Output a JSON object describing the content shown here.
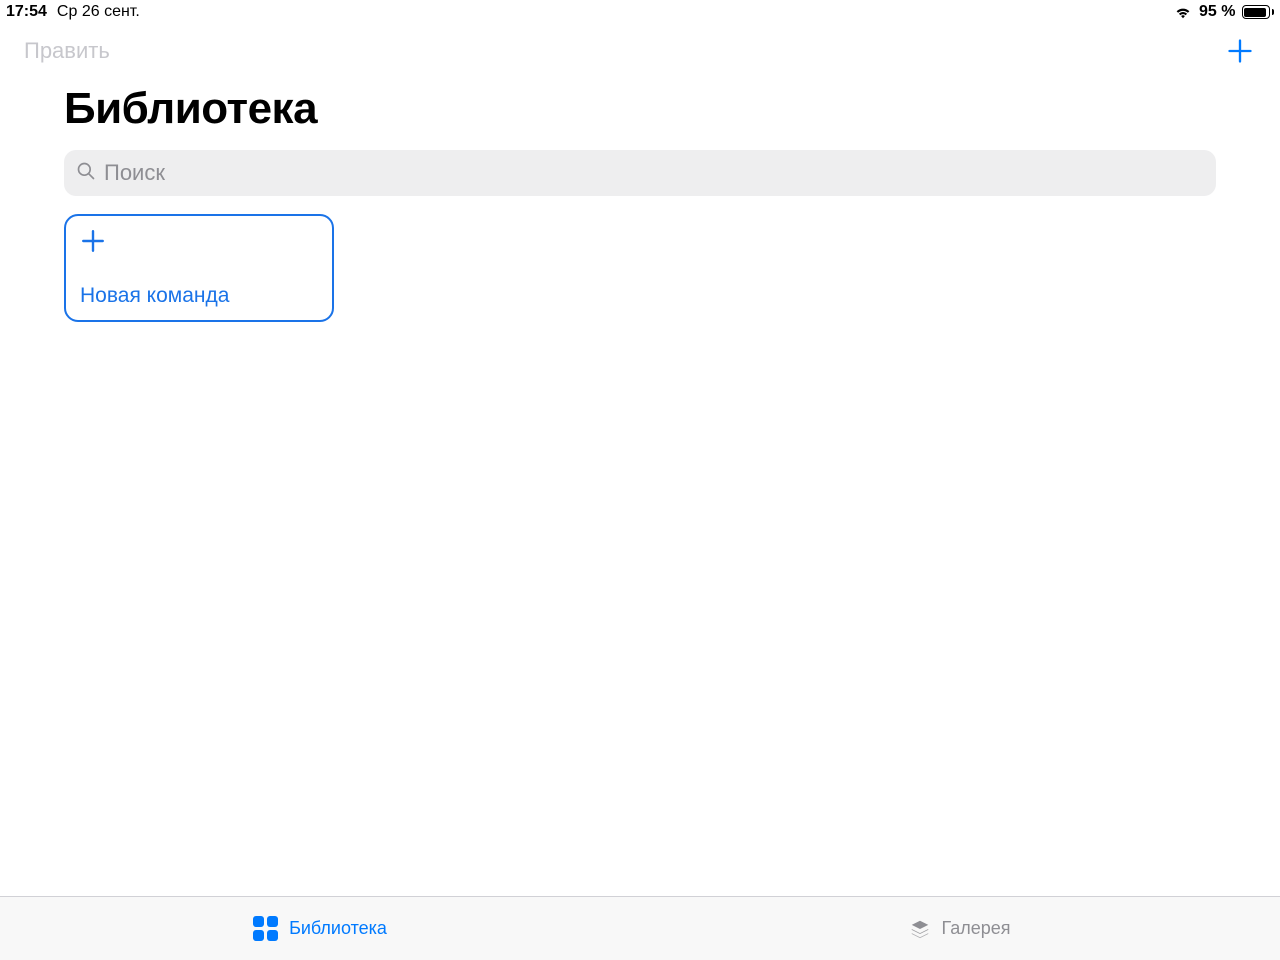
{
  "status": {
    "time": "17:54",
    "date": "Ср 26 сент.",
    "battery_pct": "95 %"
  },
  "nav": {
    "edit": "Править"
  },
  "page": {
    "title": "Библиотека"
  },
  "search": {
    "placeholder": "Поиск"
  },
  "card": {
    "label": "Новая команда"
  },
  "tabs": {
    "library": "Библиотека",
    "gallery": "Галерея"
  }
}
